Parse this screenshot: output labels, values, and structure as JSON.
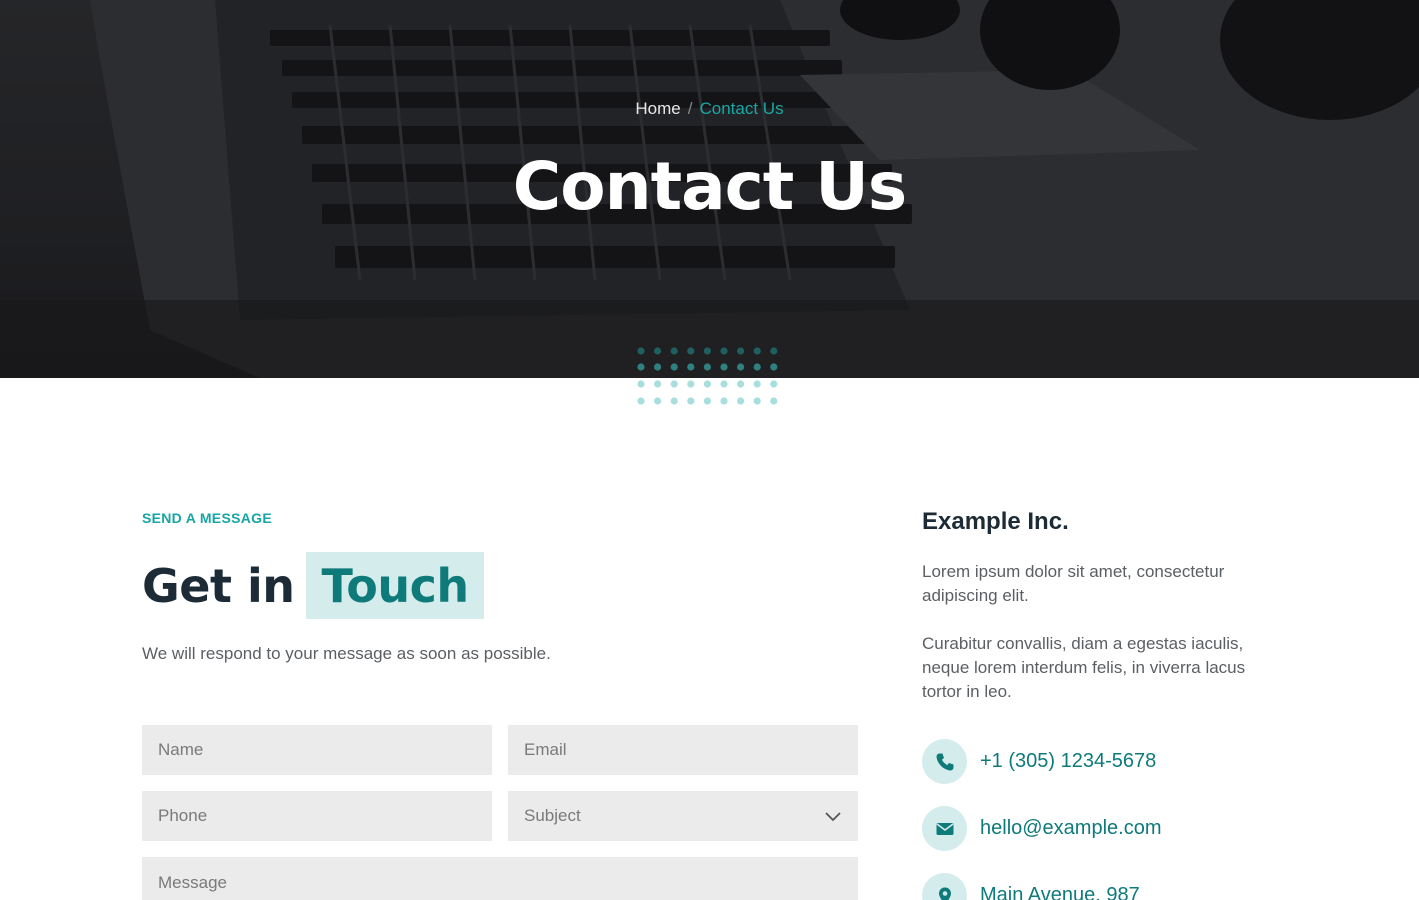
{
  "hero": {
    "breadcrumb": {
      "home": "Home",
      "separator": "/",
      "current": "Contact Us"
    },
    "title": "Contact Us"
  },
  "form_section": {
    "eyebrow": "SEND A MESSAGE",
    "heading_plain": "Get in",
    "heading_highlight": "Touch",
    "subtext": "We will respond to your message as soon as possible.",
    "fields": {
      "name": "Name",
      "email": "Email",
      "phone": "Phone",
      "subject": "Subject",
      "message": "Message"
    }
  },
  "info": {
    "company": "Example Inc.",
    "paragraph1": "Lorem ipsum dolor sit amet, consectetur adipiscing elit.",
    "paragraph2": "Curabitur convallis, diam a egestas iaculis, neque lorem interdum felis, in viverra lacus tortor in leo.",
    "phone": "+1 (305) 1234-5678",
    "email": "hello@example.com",
    "address": "Main Avenue, 987"
  },
  "icons": {
    "phone": "phone-icon",
    "email": "envelope-icon",
    "address": "map-pin-icon",
    "subject_dropdown": "chevron-down-icon"
  },
  "colors": {
    "accent": "#17a5a5",
    "accent_dark": "#0f7a7a",
    "accent_light": "#d5ecec",
    "heading": "#1c2b36",
    "body_text": "#5b5f63",
    "field_bg": "#ebebeb"
  }
}
